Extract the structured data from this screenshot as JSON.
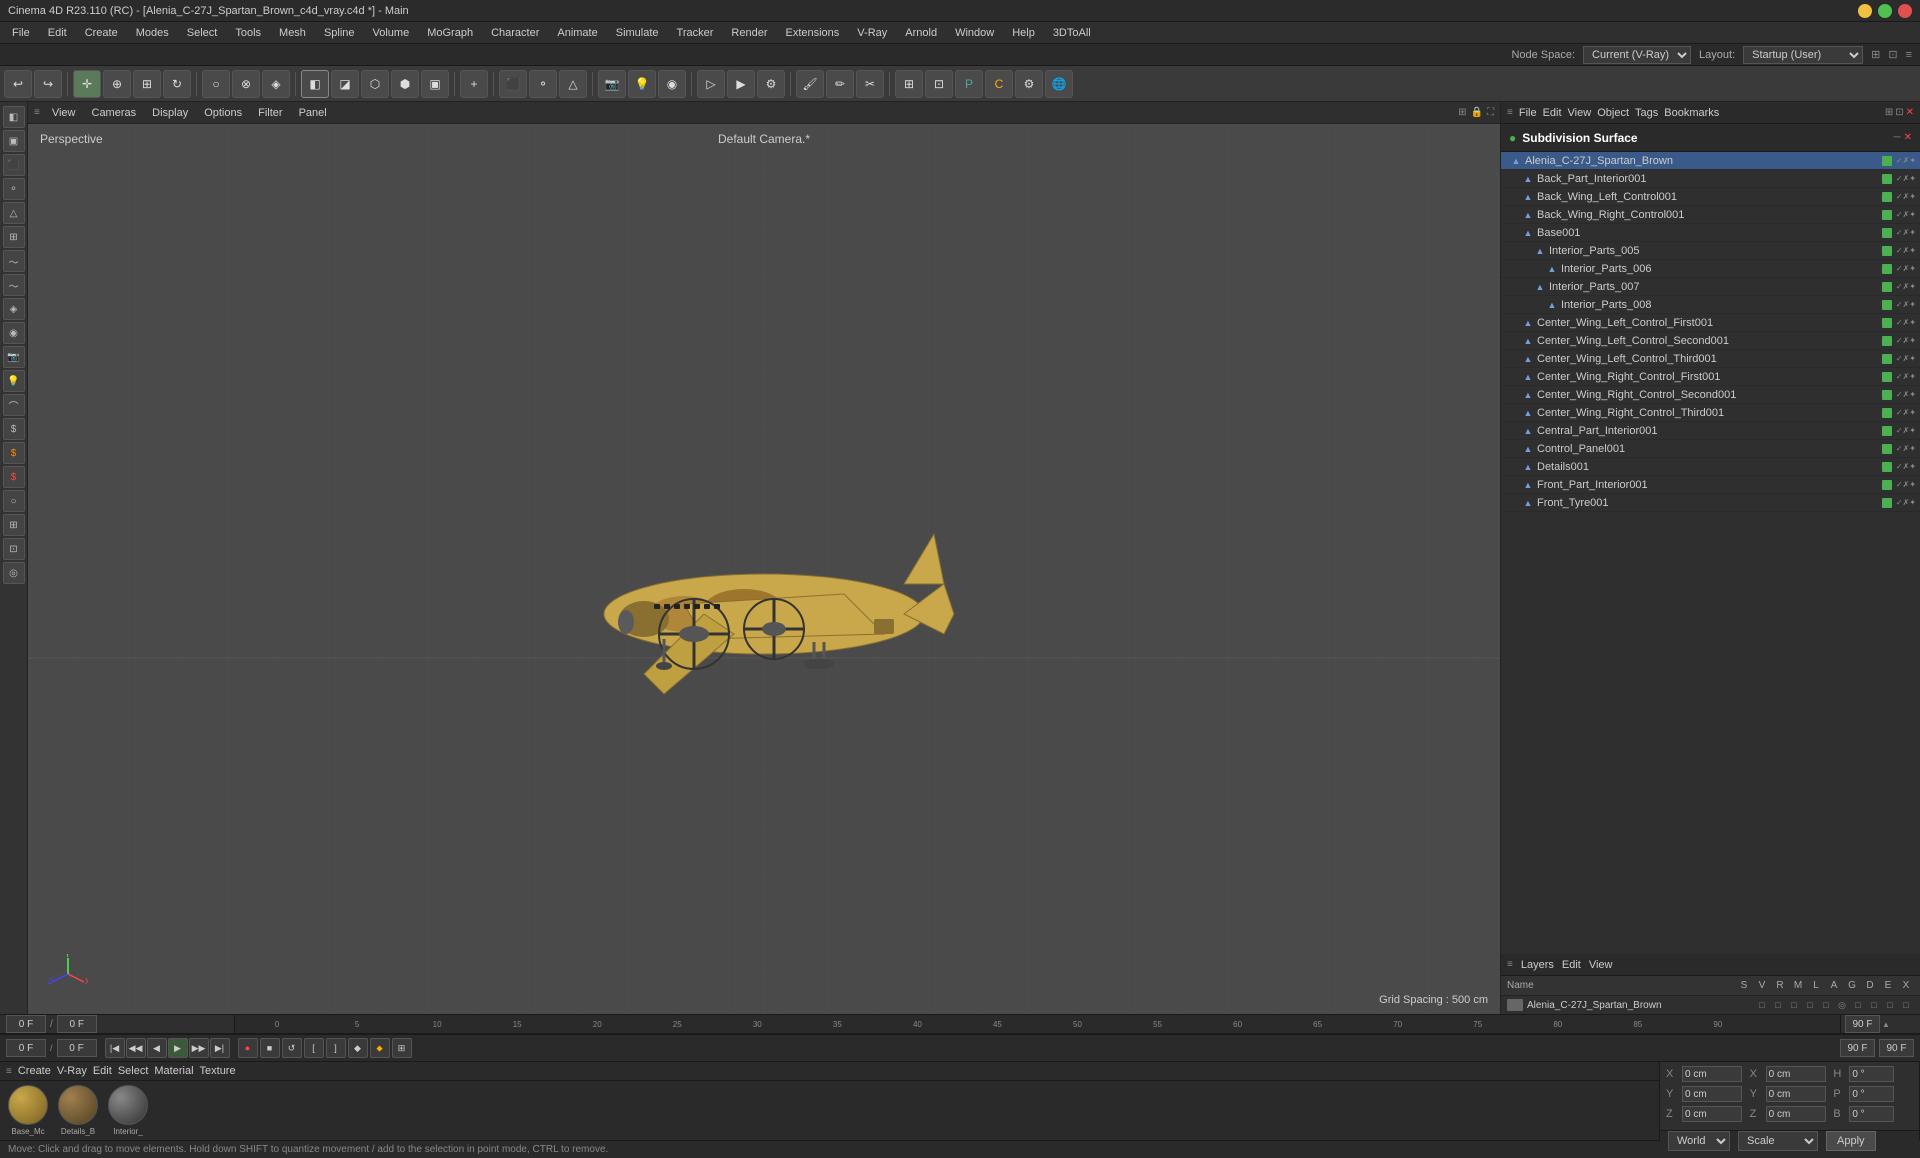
{
  "app": {
    "title": "Cinema 4D R23.110 (RC) - [Alenia_C-27J_Spartan_Brown_c4d_vray.c4d *] - Main"
  },
  "menubar": {
    "items": [
      "File",
      "Edit",
      "Create",
      "Modes",
      "Select",
      "Tools",
      "Mesh",
      "Spline",
      "Volume",
      "MoGraph",
      "Character",
      "Animate",
      "Simulate",
      "Tracker",
      "Render",
      "Extensions",
      "V-Ray",
      "Arnold",
      "Window",
      "Help",
      "3DToAll"
    ]
  },
  "viewport": {
    "label_perspective": "Perspective",
    "label_camera": "Default Camera.*",
    "grid_spacing": "Grid Spacing : 500 cm",
    "vp_menus": [
      "View",
      "Cameras",
      "Display",
      "Options",
      "Filter",
      "Panel"
    ]
  },
  "object_manager": {
    "title": "Subdivision Surface",
    "menus": [
      "File",
      "Edit",
      "View",
      "Object",
      "Tags",
      "Bookmarks"
    ],
    "objects": [
      {
        "name": "Alenia_C-27J_Spartan_Brown",
        "level": 0,
        "icon": "▲",
        "active": true
      },
      {
        "name": "Back_Part_Interior001",
        "level": 1,
        "icon": "▲"
      },
      {
        "name": "Back_Wing_Left_Control001",
        "level": 1,
        "icon": "▲"
      },
      {
        "name": "Back_Wing_Right_Control001",
        "level": 1,
        "icon": "▲"
      },
      {
        "name": "Base001",
        "level": 1,
        "icon": "▲"
      },
      {
        "name": "Interior_Parts_005",
        "level": 2,
        "icon": "▲"
      },
      {
        "name": "Interior_Parts_006",
        "level": 3,
        "icon": "▲"
      },
      {
        "name": "Interior_Parts_007",
        "level": 2,
        "icon": "▲"
      },
      {
        "name": "Interior_Parts_008",
        "level": 3,
        "icon": "▲"
      },
      {
        "name": "Center_Wing_Left_Control_First001",
        "level": 1,
        "icon": "▲"
      },
      {
        "name": "Center_Wing_Left_Control_Second001",
        "level": 1,
        "icon": "▲"
      },
      {
        "name": "Center_Wing_Left_Control_Third001",
        "level": 1,
        "icon": "▲"
      },
      {
        "name": "Center_Wing_Right_Control_First001",
        "level": 1,
        "icon": "▲"
      },
      {
        "name": "Center_Wing_Right_Control_Second001",
        "level": 1,
        "icon": "▲"
      },
      {
        "name": "Center_Wing_Right_Control_Third001",
        "level": 1,
        "icon": "▲"
      },
      {
        "name": "Central_Part_Interior001",
        "level": 1,
        "icon": "▲"
      },
      {
        "name": "Control_Panel001",
        "level": 1,
        "icon": "▲"
      },
      {
        "name": "Details001",
        "level": 1,
        "icon": "▲"
      },
      {
        "name": "Front_Part_Interior001",
        "level": 1,
        "icon": "▲"
      },
      {
        "name": "Front_Tyre001",
        "level": 1,
        "icon": "▲"
      }
    ]
  },
  "layers_panel": {
    "menus": [
      "Layers",
      "Edit",
      "View"
    ],
    "columns": [
      "Name",
      "S",
      "V",
      "R",
      "M",
      "L",
      "A",
      "G",
      "D",
      "E",
      "X"
    ],
    "row": {
      "name": "Alenia_C-27J_Spartan_Brown"
    }
  },
  "timeline": {
    "frame_start": "0",
    "frame_end": "90 F",
    "current_frame": "0 F",
    "frame_current_2": "90 F",
    "frame_labels": [
      "0",
      "5",
      "10",
      "15",
      "20",
      "25",
      "30",
      "35",
      "40",
      "45",
      "50",
      "55",
      "60",
      "65",
      "70",
      "75",
      "80",
      "85",
      "90"
    ]
  },
  "material_bar": {
    "menus": [
      "Create",
      "V-Ray",
      "Edit",
      "Select",
      "Material",
      "Texture"
    ],
    "materials": [
      {
        "name": "Base_Mc",
        "type": "sphere"
      },
      {
        "name": "Details_B",
        "type": "sphere"
      },
      {
        "name": "Interior_",
        "type": "sphere"
      }
    ]
  },
  "coordinates": {
    "x_pos": "0 cm",
    "y_pos": "0 cm",
    "z_pos": "0 cm",
    "x_scale": "0 cm",
    "y_scale": "0 cm",
    "z_scale": "0 cm",
    "h": "0°",
    "p": "0°",
    "b": "0°",
    "world_label": "World",
    "scale_label": "Scale",
    "apply_label": "Apply"
  },
  "status_bar": {
    "text": "Move: Click and drag to move elements. Hold down SHIFT to quantize movement / add to the selection in point mode, CTRL to remove."
  },
  "node_space": {
    "label": "Node Space:",
    "value": "Current (V-Ray)",
    "layout_label": "Layout:",
    "layout_value": "Startup (User)"
  },
  "subdiv": {
    "title": "Subdivision Surface"
  },
  "anim_frame": {
    "left": "0 F",
    "right": "0 F",
    "end": "90 F",
    "end2": "90 F"
  }
}
